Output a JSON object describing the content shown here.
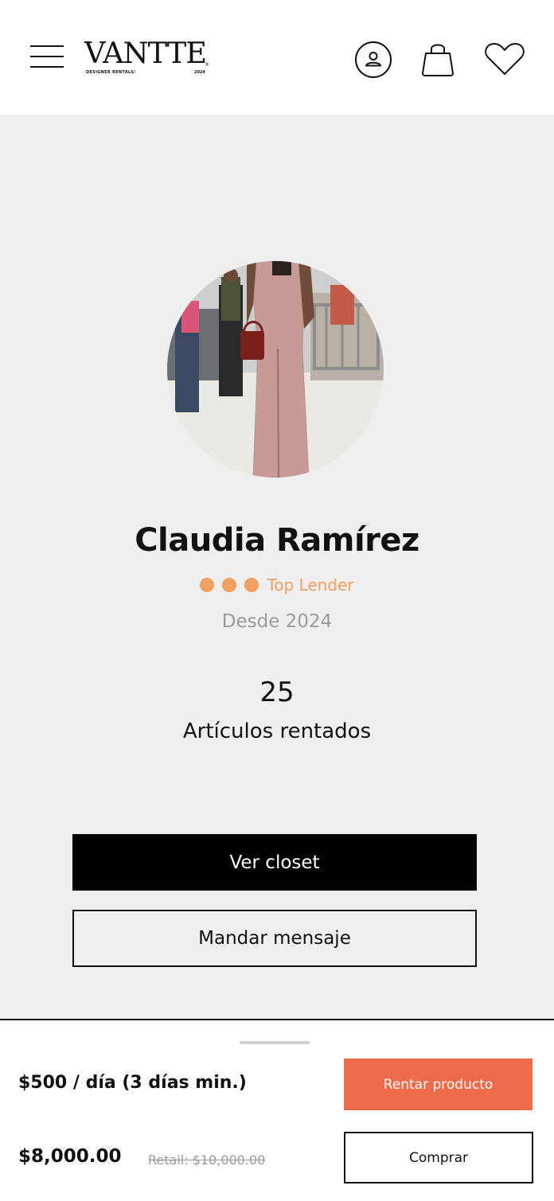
{
  "header": {
    "logo_word": "VANTTE",
    "logo_registered": "®",
    "logo_subtitle": "DESIGNER RENTALS/",
    "logo_year": "2024",
    "icons": [
      "menu-icon",
      "account-icon",
      "shopping-bag-icon",
      "heart-icon"
    ]
  },
  "profile": {
    "name": "Claudia Ramírez",
    "badge_label": "Top Lender",
    "badge_color": "#f0a061",
    "badge_dots": 3,
    "since": "Desde 2024",
    "rented_count": "25",
    "rented_label": "Artículos rentados",
    "view_closet_label": "Ver closet",
    "message_label": "Mandar mensaje"
  },
  "purchase": {
    "rent_price": "$500 / día (3 días min.)",
    "buy_price": "$8,000.00",
    "retail_price": "Retail: $10,000.00",
    "rent_button": "Rentar producto",
    "buy_button": "Comprar",
    "accent_color": "#ec6c4a"
  }
}
